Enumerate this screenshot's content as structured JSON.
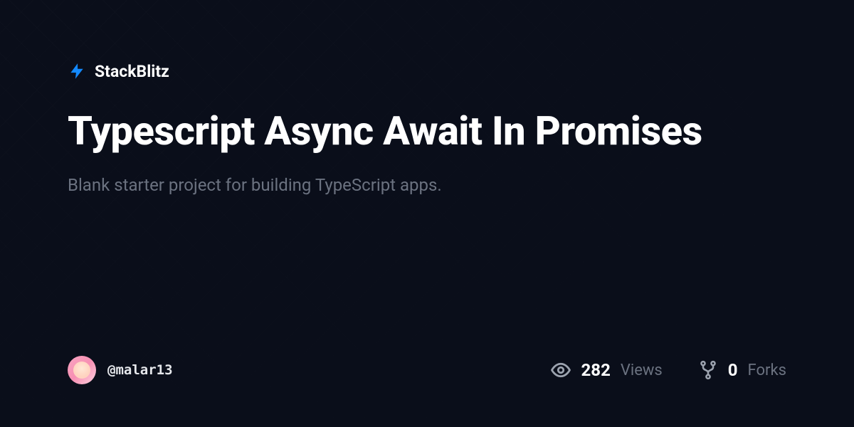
{
  "brand": {
    "name": "StackBlitz",
    "accent_color": "#1389fd"
  },
  "project": {
    "title": "Typescript Async Await In Promises",
    "description": "Blank starter project for building TypeScript apps."
  },
  "author": {
    "username": "@malar13"
  },
  "stats": {
    "views": {
      "count": "282",
      "label": "Views"
    },
    "forks": {
      "count": "0",
      "label": "Forks"
    }
  }
}
